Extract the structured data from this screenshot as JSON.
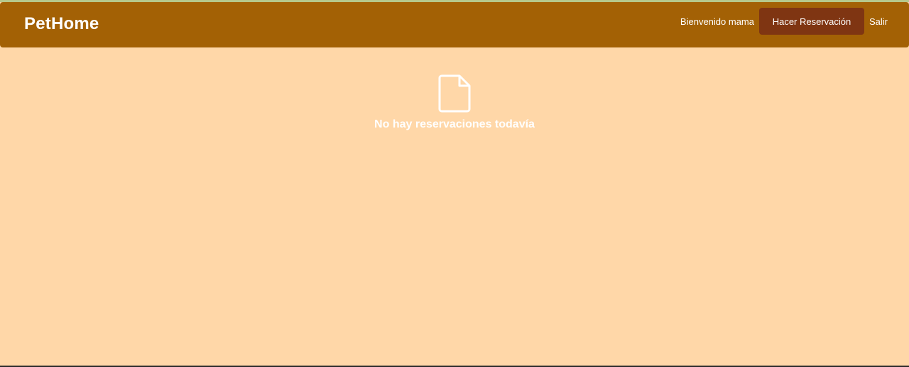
{
  "app": {
    "brand": "PetHome"
  },
  "nav": {
    "welcome": "Bienvenido mama",
    "reserve_button": "Hacer Reservación",
    "logout": "Salir"
  },
  "empty_state": {
    "icon": "document-icon",
    "message": "No hay reservaciones todavía"
  },
  "colors": {
    "background": "#ffd7a8",
    "navbar": "#a36105",
    "button": "#7f3512",
    "text": "#ffffff"
  }
}
